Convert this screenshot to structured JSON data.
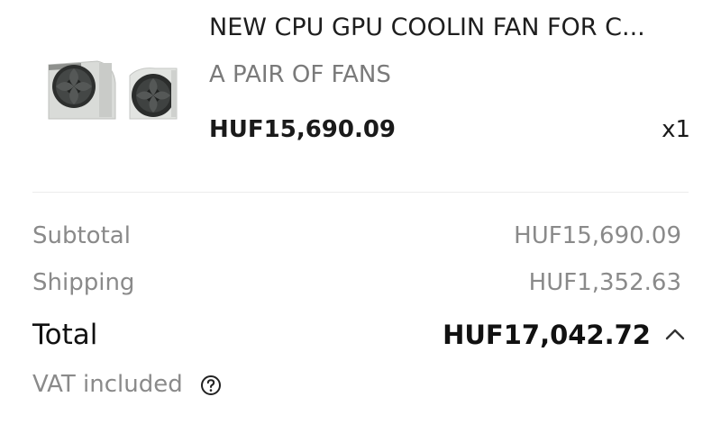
{
  "product": {
    "title": "NEW CPU GPU COOLIN FAN FOR C...",
    "variant": "A PAIR OF FANS",
    "price": "HUF15,690.09",
    "quantity": "x1",
    "image_icon": "cooling-fans-image"
  },
  "summary": {
    "subtotal_label": "Subtotal",
    "subtotal_value": "HUF15,690.09",
    "shipping_label": "Shipping",
    "shipping_value": "HUF1,352.63",
    "total_label": "Total",
    "total_value": "HUF17,042.72",
    "vat_label": "VAT included",
    "collapse_icon": "chevron-up-icon",
    "help_icon": "question-circle-icon"
  },
  "colors": {
    "text_primary": "#1a1a1a",
    "text_secondary": "#8a8a8a",
    "divider": "#ececec",
    "background": "#ffffff"
  }
}
